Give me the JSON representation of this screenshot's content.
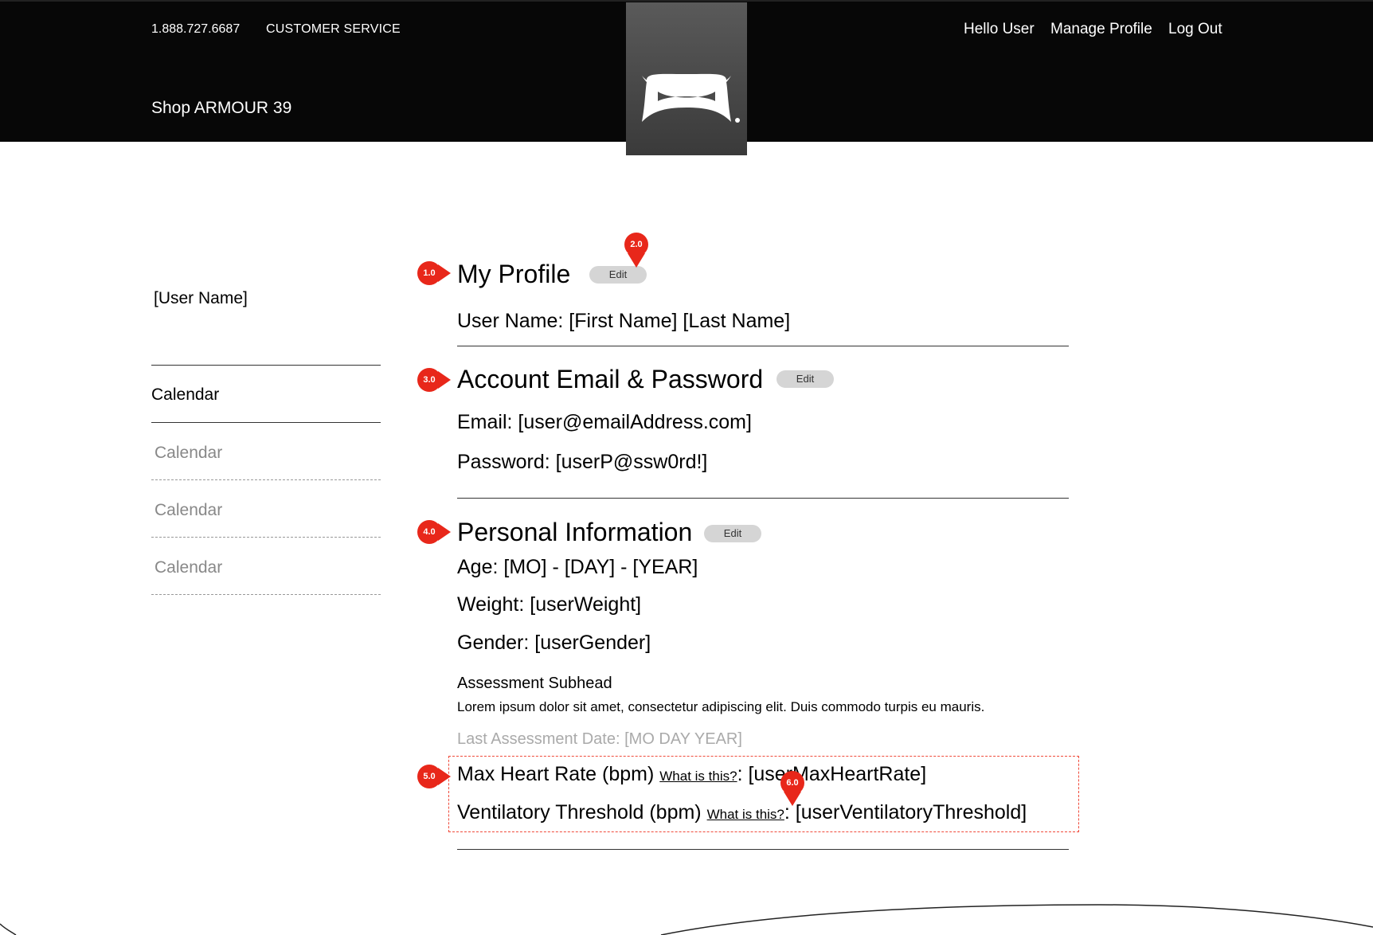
{
  "header": {
    "phone": "1.888.727.6687",
    "customer_service": "CUSTOMER SERVICE",
    "shop": "Shop ARMOUR 39",
    "greeting": "Hello User",
    "manage_profile": "Manage Profile",
    "log_out": "Log Out",
    "logo": "under-armour-logo"
  },
  "sidebar": {
    "user_name": "[User Name]",
    "items": [
      {
        "label": "Calendar",
        "active": true
      },
      {
        "label": "Calendar",
        "active": false
      },
      {
        "label": "Calendar",
        "active": false
      },
      {
        "label": "Calendar",
        "active": false
      }
    ]
  },
  "profile": {
    "title": "My Profile",
    "edit": "Edit",
    "user_name": "User Name: [First Name] [Last Name]"
  },
  "account": {
    "title": "Account Email & Password",
    "edit": "Edit",
    "email": "Email: [user@emailAddress.com]",
    "password": "Password: [userP@ssw0rd!]"
  },
  "personal": {
    "title": "Personal Information",
    "edit": "Edit",
    "age": "Age: [MO] - [DAY] - [YEAR]",
    "weight": "Weight: [userWeight]",
    "gender": "Gender: [userGender]",
    "assessment_subhead": "Assessment Subhead",
    "lorem": "Lorem ipsum dolor sit amet, consectetur adipiscing elit. Duis commodo turpis eu mauris.",
    "last_assessment": "Last Assessment Date: [MO DAY YEAR]",
    "max_hr_label": "Max Heart Rate (bpm) ",
    "what_is_this": "What is this?",
    "max_hr_value": ": [userMaxHeartRate]",
    "vt_label": "Ventilatory Threshold (bpm) ",
    "vt_value": ": [userVentilatoryThreshold]"
  },
  "annotations": {
    "m1": "1.0",
    "m2": "2.0",
    "m3": "3.0",
    "m4": "4.0",
    "m5": "5.0",
    "m6": "6.0"
  },
  "colors": {
    "header_bg": "#070707",
    "accent_red": "#e8271a",
    "button_gray": "#d5d5d5",
    "muted_text": "#888888"
  }
}
